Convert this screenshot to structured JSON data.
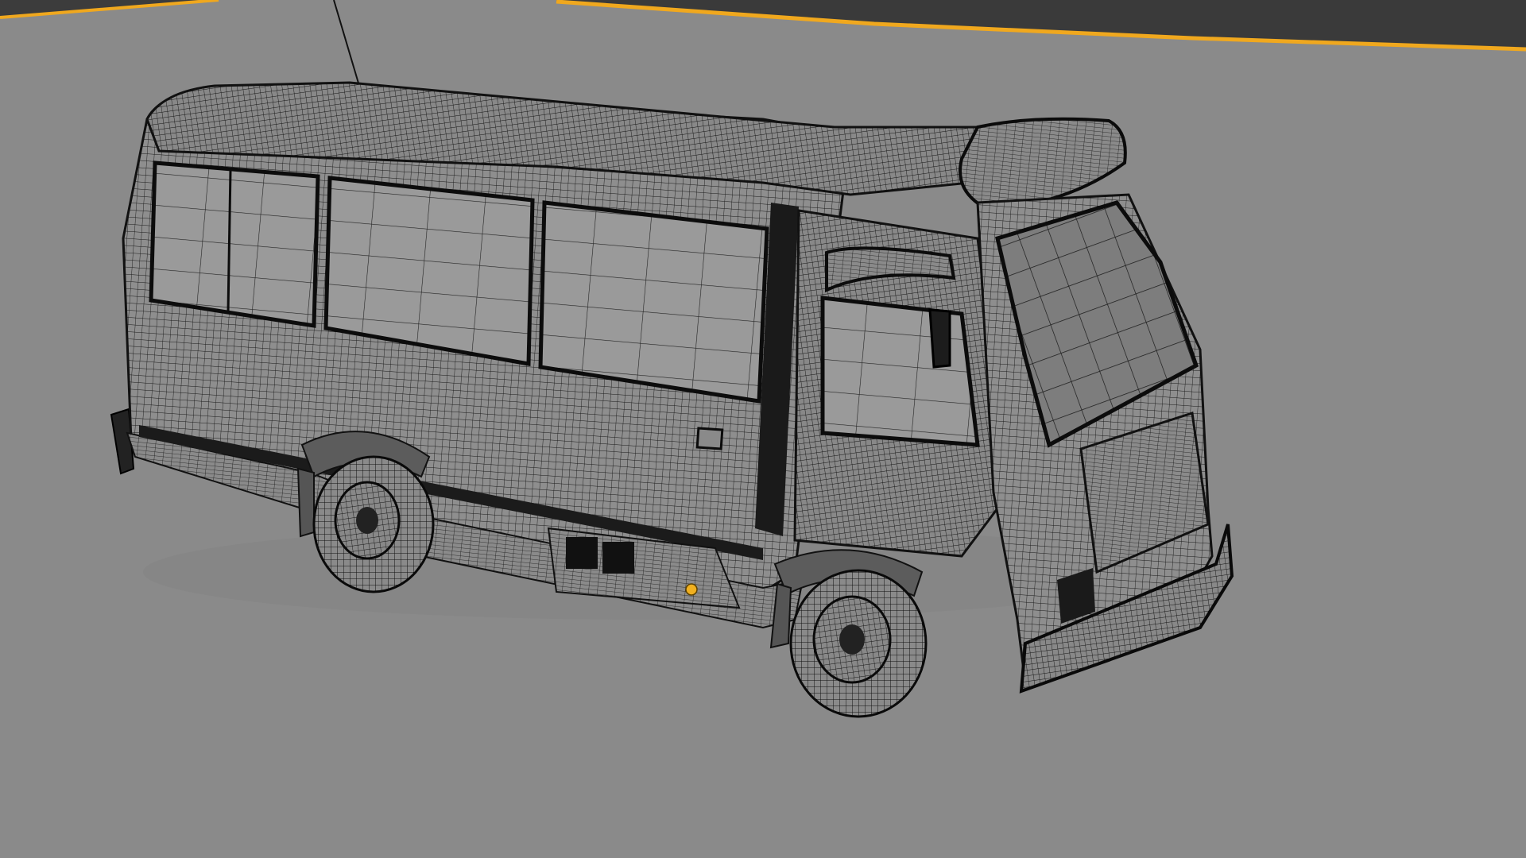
{
  "viewport": {
    "kind": "3d-modeling-viewport",
    "shading": "wireframe-on-solid",
    "background_color": "#8a8a8a",
    "selection_outline_color": "#f0a81e",
    "dark_backdrop_color": "#3a3a3a"
  },
  "scene": {
    "object": "minibus",
    "object_icon": "bus-model",
    "object_origin_color": "#f0b020",
    "mesh_wire_color": "#151515",
    "mesh_fill_color": "#8e8e8e",
    "glass_fill_color": "#9a9a9a"
  }
}
